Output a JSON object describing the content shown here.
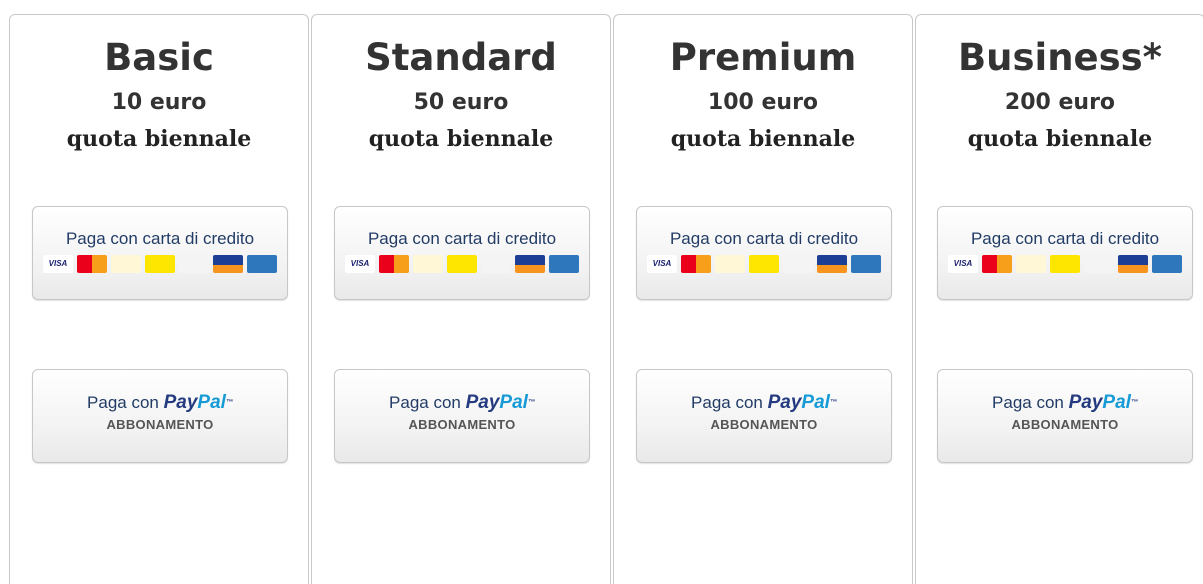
{
  "plans": [
    {
      "name": "Basic",
      "price": "10 euro",
      "period": "quota biennale"
    },
    {
      "name": "Standard",
      "price": "50 euro",
      "period": "quota biennale"
    },
    {
      "name": "Premium",
      "price": "100 euro",
      "period": "quota biennale"
    },
    {
      "name": "Business*",
      "price": "200 euro",
      "period": "quota biennale"
    }
  ],
  "card_button": {
    "label": "Paga con carta di credito",
    "cards": [
      {
        "icon": "visa-icon",
        "text": "VISA"
      },
      {
        "icon": "mastercard-icon",
        "text": "MasterCard"
      },
      {
        "icon": "paypal-card-icon",
        "text": "PayPal"
      },
      {
        "icon": "postepay-icon",
        "text": "postepay"
      },
      {
        "icon": "discover-icon",
        "text": "DISCOVER"
      },
      {
        "icon": "aurora-icon",
        "text": "Aurora"
      },
      {
        "icon": "amex-icon",
        "text": "AMERICAN EXPRESS"
      }
    ]
  },
  "paypal_button": {
    "prefix": "Paga con",
    "logo_part1": "Pay",
    "logo_part2": "Pal",
    "logo_tm": "™",
    "subtitle": "ABBONAMENTO"
  }
}
